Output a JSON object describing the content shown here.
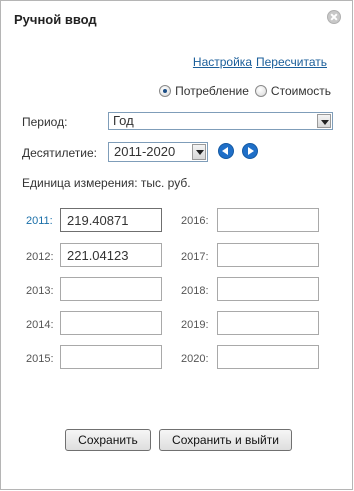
{
  "dialog": {
    "title": "Ручной ввод"
  },
  "links": {
    "settings": "Настройка",
    "recalculate": "Пересчитать"
  },
  "radio": {
    "options": [
      {
        "label": "Потребление",
        "checked": true
      },
      {
        "label": "Стоимость",
        "checked": false
      }
    ]
  },
  "period": {
    "label": "Период:",
    "value": "Год"
  },
  "decade": {
    "label": "Десятилетие:",
    "value": "2011-2020"
  },
  "units": {
    "text": "Единица измерения: тыс. руб."
  },
  "years": [
    {
      "label": "2011:",
      "value": "219.40871"
    },
    {
      "label": "2012:",
      "value": "221.04123"
    },
    {
      "label": "2013:",
      "value": ""
    },
    {
      "label": "2014:",
      "value": ""
    },
    {
      "label": "2015:",
      "value": ""
    },
    {
      "label": "2016:",
      "value": ""
    },
    {
      "label": "2017:",
      "value": ""
    },
    {
      "label": "2018:",
      "value": ""
    },
    {
      "label": "2019:",
      "value": ""
    },
    {
      "label": "2020:",
      "value": ""
    }
  ],
  "buttons": {
    "save": "Сохранить",
    "save_exit": "Сохранить и выйти"
  },
  "icons": {
    "close": "close-icon",
    "prev": "arrow-left-icon",
    "next": "arrow-right-icon",
    "dropdown": "chevron-down-icon"
  },
  "colors": {
    "link": "#1a5e9a",
    "active_year_label": "#1a6fa8",
    "nav_button": "#1f6fc8"
  }
}
